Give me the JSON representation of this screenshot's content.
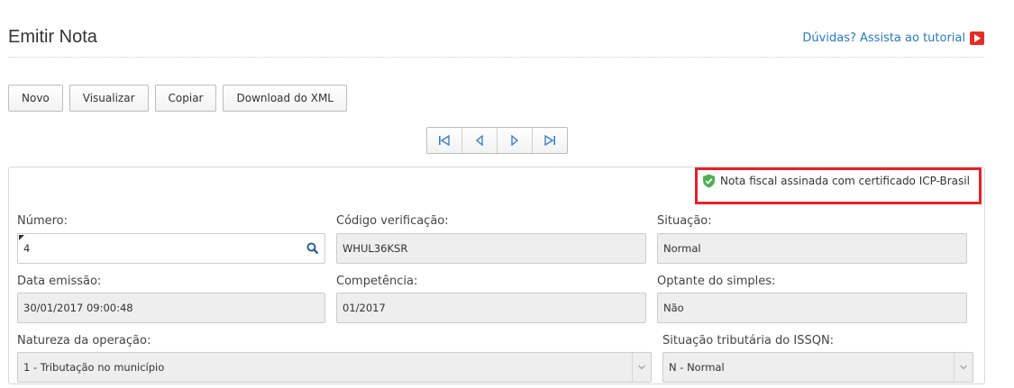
{
  "header": {
    "title": "Emitir Nota",
    "tutorial_link": "Dúvidas? Assista ao tutorial"
  },
  "toolbar": {
    "buttons": [
      "Novo",
      "Visualizar",
      "Copiar",
      "Download do XML"
    ]
  },
  "pager": {
    "buttons": [
      "first-icon",
      "previous-icon",
      "next-icon",
      "last-icon"
    ]
  },
  "certificate": {
    "text": "Nota fiscal assinada com certificado ICP-Brasil"
  },
  "form": {
    "numero": {
      "label": "Número:",
      "value": "4"
    },
    "codigo_verificacao": {
      "label": "Código verificação:",
      "value": "WHUL36KSR"
    },
    "situacao": {
      "label": "Situação:",
      "value": "Normal"
    },
    "data_emissao": {
      "label": "Data emissão:",
      "value": "30/01/2017 09:00:48"
    },
    "competencia": {
      "label": "Competência:",
      "value": "01/2017"
    },
    "optante_simples": {
      "label": "Optante do simples:",
      "value": "Não"
    },
    "natureza_operacao": {
      "label": "Natureza da operação:",
      "value": "1 - Tributação no município"
    },
    "situacao_tributaria": {
      "label": "Situação tributária do ISSQN:",
      "value": "N - Normal"
    }
  },
  "colors": {
    "link": "#2a7ab8",
    "highlight": "#e3222a",
    "shield": "#4caf50",
    "youtube": "#e52d27",
    "pager_icon": "#3d7fc1"
  }
}
